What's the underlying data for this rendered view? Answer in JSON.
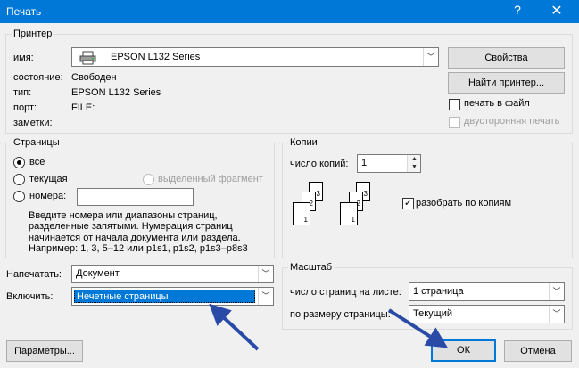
{
  "window": {
    "title": "Печать",
    "help_glyph": "?",
    "close_glyph": "✕"
  },
  "printer": {
    "legend": "Принтер",
    "name_label": "имя:",
    "name_value": "EPSON L132 Series",
    "status_label": "состояние:",
    "status_value": "Свободен",
    "type_label": "тип:",
    "type_value": "EPSON L132 Series",
    "port_label": "порт:",
    "port_value": "FILE:",
    "comment_label": "заметки:",
    "properties_button": "Свойства",
    "find_printer_button": "Найти принтер...",
    "print_to_file_label": "печать в файл",
    "duplex_label": "двусторонняя печать"
  },
  "pages": {
    "legend": "Страницы",
    "all_label": "все",
    "current_label": "текущая",
    "selection_label": "выделенный фрагмент",
    "numbers_label": "номера:",
    "numbers_value": "",
    "hint_line1": "Введите номера или диапазоны страниц,",
    "hint_line2": "разделенные запятыми. Нумерация страниц",
    "hint_line3": "начинается от начала документа или раздела.",
    "hint_line4": "Например: 1, 3, 5–12 или p1s1, p1s2, p1s3–p8s3"
  },
  "copies": {
    "legend": "Копии",
    "count_label": "число копий:",
    "count_value": "1",
    "collate_label": "разобрать по копиям",
    "page_nums": [
      "1",
      "2",
      "3"
    ]
  },
  "print_what": {
    "label": "Напечатать:",
    "value": "Документ"
  },
  "include": {
    "label": "Включить:",
    "value": "Нечетные страницы"
  },
  "zoom": {
    "legend": "Масштаб",
    "pages_per_sheet_label": "число страниц на листе:",
    "pages_per_sheet_value": "1 страница",
    "scale_label": "по размеру страницы:",
    "scale_value": "Текущий"
  },
  "buttons": {
    "options": "Параметры...",
    "ok": "ОК",
    "cancel": "Отмена"
  },
  "colors": {
    "accent": "#0078d7",
    "annotation_arrow": "#2a4aa8"
  }
}
